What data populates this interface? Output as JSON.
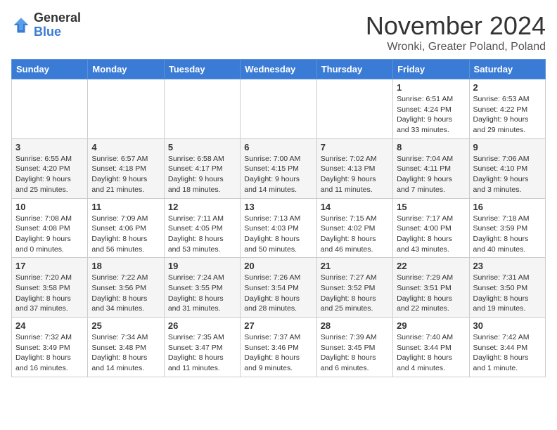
{
  "logo": {
    "general": "General",
    "blue": "Blue"
  },
  "title": "November 2024",
  "location": "Wronki, Greater Poland, Poland",
  "days_of_week": [
    "Sunday",
    "Monday",
    "Tuesday",
    "Wednesday",
    "Thursday",
    "Friday",
    "Saturday"
  ],
  "weeks": [
    [
      {
        "day": "",
        "info": ""
      },
      {
        "day": "",
        "info": ""
      },
      {
        "day": "",
        "info": ""
      },
      {
        "day": "",
        "info": ""
      },
      {
        "day": "",
        "info": ""
      },
      {
        "day": "1",
        "info": "Sunrise: 6:51 AM\nSunset: 4:24 PM\nDaylight: 9 hours and 33 minutes."
      },
      {
        "day": "2",
        "info": "Sunrise: 6:53 AM\nSunset: 4:22 PM\nDaylight: 9 hours and 29 minutes."
      }
    ],
    [
      {
        "day": "3",
        "info": "Sunrise: 6:55 AM\nSunset: 4:20 PM\nDaylight: 9 hours and 25 minutes."
      },
      {
        "day": "4",
        "info": "Sunrise: 6:57 AM\nSunset: 4:18 PM\nDaylight: 9 hours and 21 minutes."
      },
      {
        "day": "5",
        "info": "Sunrise: 6:58 AM\nSunset: 4:17 PM\nDaylight: 9 hours and 18 minutes."
      },
      {
        "day": "6",
        "info": "Sunrise: 7:00 AM\nSunset: 4:15 PM\nDaylight: 9 hours and 14 minutes."
      },
      {
        "day": "7",
        "info": "Sunrise: 7:02 AM\nSunset: 4:13 PM\nDaylight: 9 hours and 11 minutes."
      },
      {
        "day": "8",
        "info": "Sunrise: 7:04 AM\nSunset: 4:11 PM\nDaylight: 9 hours and 7 minutes."
      },
      {
        "day": "9",
        "info": "Sunrise: 7:06 AM\nSunset: 4:10 PM\nDaylight: 9 hours and 3 minutes."
      }
    ],
    [
      {
        "day": "10",
        "info": "Sunrise: 7:08 AM\nSunset: 4:08 PM\nDaylight: 9 hours and 0 minutes."
      },
      {
        "day": "11",
        "info": "Sunrise: 7:09 AM\nSunset: 4:06 PM\nDaylight: 8 hours and 56 minutes."
      },
      {
        "day": "12",
        "info": "Sunrise: 7:11 AM\nSunset: 4:05 PM\nDaylight: 8 hours and 53 minutes."
      },
      {
        "day": "13",
        "info": "Sunrise: 7:13 AM\nSunset: 4:03 PM\nDaylight: 8 hours and 50 minutes."
      },
      {
        "day": "14",
        "info": "Sunrise: 7:15 AM\nSunset: 4:02 PM\nDaylight: 8 hours and 46 minutes."
      },
      {
        "day": "15",
        "info": "Sunrise: 7:17 AM\nSunset: 4:00 PM\nDaylight: 8 hours and 43 minutes."
      },
      {
        "day": "16",
        "info": "Sunrise: 7:18 AM\nSunset: 3:59 PM\nDaylight: 8 hours and 40 minutes."
      }
    ],
    [
      {
        "day": "17",
        "info": "Sunrise: 7:20 AM\nSunset: 3:58 PM\nDaylight: 8 hours and 37 minutes."
      },
      {
        "day": "18",
        "info": "Sunrise: 7:22 AM\nSunset: 3:56 PM\nDaylight: 8 hours and 34 minutes."
      },
      {
        "day": "19",
        "info": "Sunrise: 7:24 AM\nSunset: 3:55 PM\nDaylight: 8 hours and 31 minutes."
      },
      {
        "day": "20",
        "info": "Sunrise: 7:26 AM\nSunset: 3:54 PM\nDaylight: 8 hours and 28 minutes."
      },
      {
        "day": "21",
        "info": "Sunrise: 7:27 AM\nSunset: 3:52 PM\nDaylight: 8 hours and 25 minutes."
      },
      {
        "day": "22",
        "info": "Sunrise: 7:29 AM\nSunset: 3:51 PM\nDaylight: 8 hours and 22 minutes."
      },
      {
        "day": "23",
        "info": "Sunrise: 7:31 AM\nSunset: 3:50 PM\nDaylight: 8 hours and 19 minutes."
      }
    ],
    [
      {
        "day": "24",
        "info": "Sunrise: 7:32 AM\nSunset: 3:49 PM\nDaylight: 8 hours and 16 minutes."
      },
      {
        "day": "25",
        "info": "Sunrise: 7:34 AM\nSunset: 3:48 PM\nDaylight: 8 hours and 14 minutes."
      },
      {
        "day": "26",
        "info": "Sunrise: 7:35 AM\nSunset: 3:47 PM\nDaylight: 8 hours and 11 minutes."
      },
      {
        "day": "27",
        "info": "Sunrise: 7:37 AM\nSunset: 3:46 PM\nDaylight: 8 hours and 9 minutes."
      },
      {
        "day": "28",
        "info": "Sunrise: 7:39 AM\nSunset: 3:45 PM\nDaylight: 8 hours and 6 minutes."
      },
      {
        "day": "29",
        "info": "Sunrise: 7:40 AM\nSunset: 3:44 PM\nDaylight: 8 hours and 4 minutes."
      },
      {
        "day": "30",
        "info": "Sunrise: 7:42 AM\nSunset: 3:44 PM\nDaylight: 8 hours and 1 minute."
      }
    ]
  ]
}
